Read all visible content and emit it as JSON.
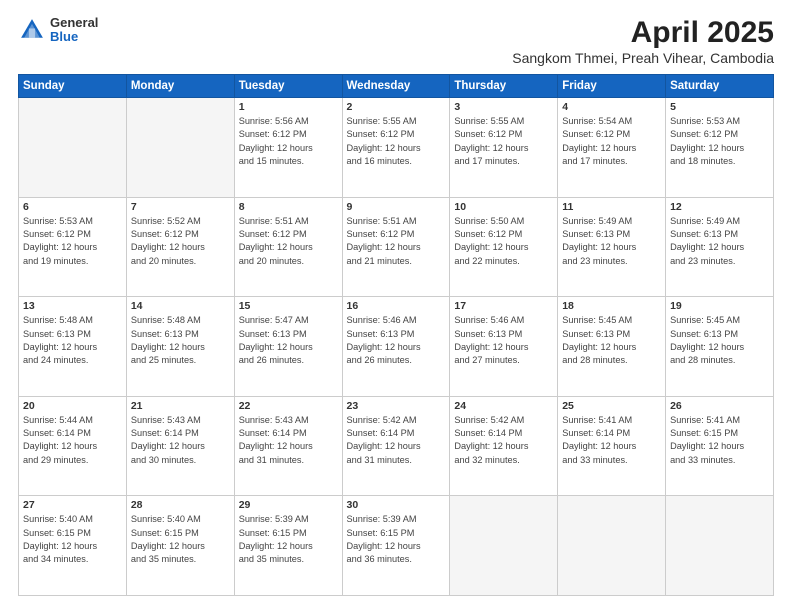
{
  "logo": {
    "general": "General",
    "blue": "Blue"
  },
  "title": "April 2025",
  "subtitle": "Sangkom Thmei, Preah Vihear, Cambodia",
  "header_days": [
    "Sunday",
    "Monday",
    "Tuesday",
    "Wednesday",
    "Thursday",
    "Friday",
    "Saturday"
  ],
  "weeks": [
    [
      {
        "day": "",
        "info": ""
      },
      {
        "day": "",
        "info": ""
      },
      {
        "day": "1",
        "info": "Sunrise: 5:56 AM\nSunset: 6:12 PM\nDaylight: 12 hours\nand 15 minutes."
      },
      {
        "day": "2",
        "info": "Sunrise: 5:55 AM\nSunset: 6:12 PM\nDaylight: 12 hours\nand 16 minutes."
      },
      {
        "day": "3",
        "info": "Sunrise: 5:55 AM\nSunset: 6:12 PM\nDaylight: 12 hours\nand 17 minutes."
      },
      {
        "day": "4",
        "info": "Sunrise: 5:54 AM\nSunset: 6:12 PM\nDaylight: 12 hours\nand 17 minutes."
      },
      {
        "day": "5",
        "info": "Sunrise: 5:53 AM\nSunset: 6:12 PM\nDaylight: 12 hours\nand 18 minutes."
      }
    ],
    [
      {
        "day": "6",
        "info": "Sunrise: 5:53 AM\nSunset: 6:12 PM\nDaylight: 12 hours\nand 19 minutes."
      },
      {
        "day": "7",
        "info": "Sunrise: 5:52 AM\nSunset: 6:12 PM\nDaylight: 12 hours\nand 20 minutes."
      },
      {
        "day": "8",
        "info": "Sunrise: 5:51 AM\nSunset: 6:12 PM\nDaylight: 12 hours\nand 20 minutes."
      },
      {
        "day": "9",
        "info": "Sunrise: 5:51 AM\nSunset: 6:12 PM\nDaylight: 12 hours\nand 21 minutes."
      },
      {
        "day": "10",
        "info": "Sunrise: 5:50 AM\nSunset: 6:12 PM\nDaylight: 12 hours\nand 22 minutes."
      },
      {
        "day": "11",
        "info": "Sunrise: 5:49 AM\nSunset: 6:13 PM\nDaylight: 12 hours\nand 23 minutes."
      },
      {
        "day": "12",
        "info": "Sunrise: 5:49 AM\nSunset: 6:13 PM\nDaylight: 12 hours\nand 23 minutes."
      }
    ],
    [
      {
        "day": "13",
        "info": "Sunrise: 5:48 AM\nSunset: 6:13 PM\nDaylight: 12 hours\nand 24 minutes."
      },
      {
        "day": "14",
        "info": "Sunrise: 5:48 AM\nSunset: 6:13 PM\nDaylight: 12 hours\nand 25 minutes."
      },
      {
        "day": "15",
        "info": "Sunrise: 5:47 AM\nSunset: 6:13 PM\nDaylight: 12 hours\nand 26 minutes."
      },
      {
        "day": "16",
        "info": "Sunrise: 5:46 AM\nSunset: 6:13 PM\nDaylight: 12 hours\nand 26 minutes."
      },
      {
        "day": "17",
        "info": "Sunrise: 5:46 AM\nSunset: 6:13 PM\nDaylight: 12 hours\nand 27 minutes."
      },
      {
        "day": "18",
        "info": "Sunrise: 5:45 AM\nSunset: 6:13 PM\nDaylight: 12 hours\nand 28 minutes."
      },
      {
        "day": "19",
        "info": "Sunrise: 5:45 AM\nSunset: 6:13 PM\nDaylight: 12 hours\nand 28 minutes."
      }
    ],
    [
      {
        "day": "20",
        "info": "Sunrise: 5:44 AM\nSunset: 6:14 PM\nDaylight: 12 hours\nand 29 minutes."
      },
      {
        "day": "21",
        "info": "Sunrise: 5:43 AM\nSunset: 6:14 PM\nDaylight: 12 hours\nand 30 minutes."
      },
      {
        "day": "22",
        "info": "Sunrise: 5:43 AM\nSunset: 6:14 PM\nDaylight: 12 hours\nand 31 minutes."
      },
      {
        "day": "23",
        "info": "Sunrise: 5:42 AM\nSunset: 6:14 PM\nDaylight: 12 hours\nand 31 minutes."
      },
      {
        "day": "24",
        "info": "Sunrise: 5:42 AM\nSunset: 6:14 PM\nDaylight: 12 hours\nand 32 minutes."
      },
      {
        "day": "25",
        "info": "Sunrise: 5:41 AM\nSunset: 6:14 PM\nDaylight: 12 hours\nand 33 minutes."
      },
      {
        "day": "26",
        "info": "Sunrise: 5:41 AM\nSunset: 6:15 PM\nDaylight: 12 hours\nand 33 minutes."
      }
    ],
    [
      {
        "day": "27",
        "info": "Sunrise: 5:40 AM\nSunset: 6:15 PM\nDaylight: 12 hours\nand 34 minutes."
      },
      {
        "day": "28",
        "info": "Sunrise: 5:40 AM\nSunset: 6:15 PM\nDaylight: 12 hours\nand 35 minutes."
      },
      {
        "day": "29",
        "info": "Sunrise: 5:39 AM\nSunset: 6:15 PM\nDaylight: 12 hours\nand 35 minutes."
      },
      {
        "day": "30",
        "info": "Sunrise: 5:39 AM\nSunset: 6:15 PM\nDaylight: 12 hours\nand 36 minutes."
      },
      {
        "day": "",
        "info": ""
      },
      {
        "day": "",
        "info": ""
      },
      {
        "day": "",
        "info": ""
      }
    ]
  ]
}
